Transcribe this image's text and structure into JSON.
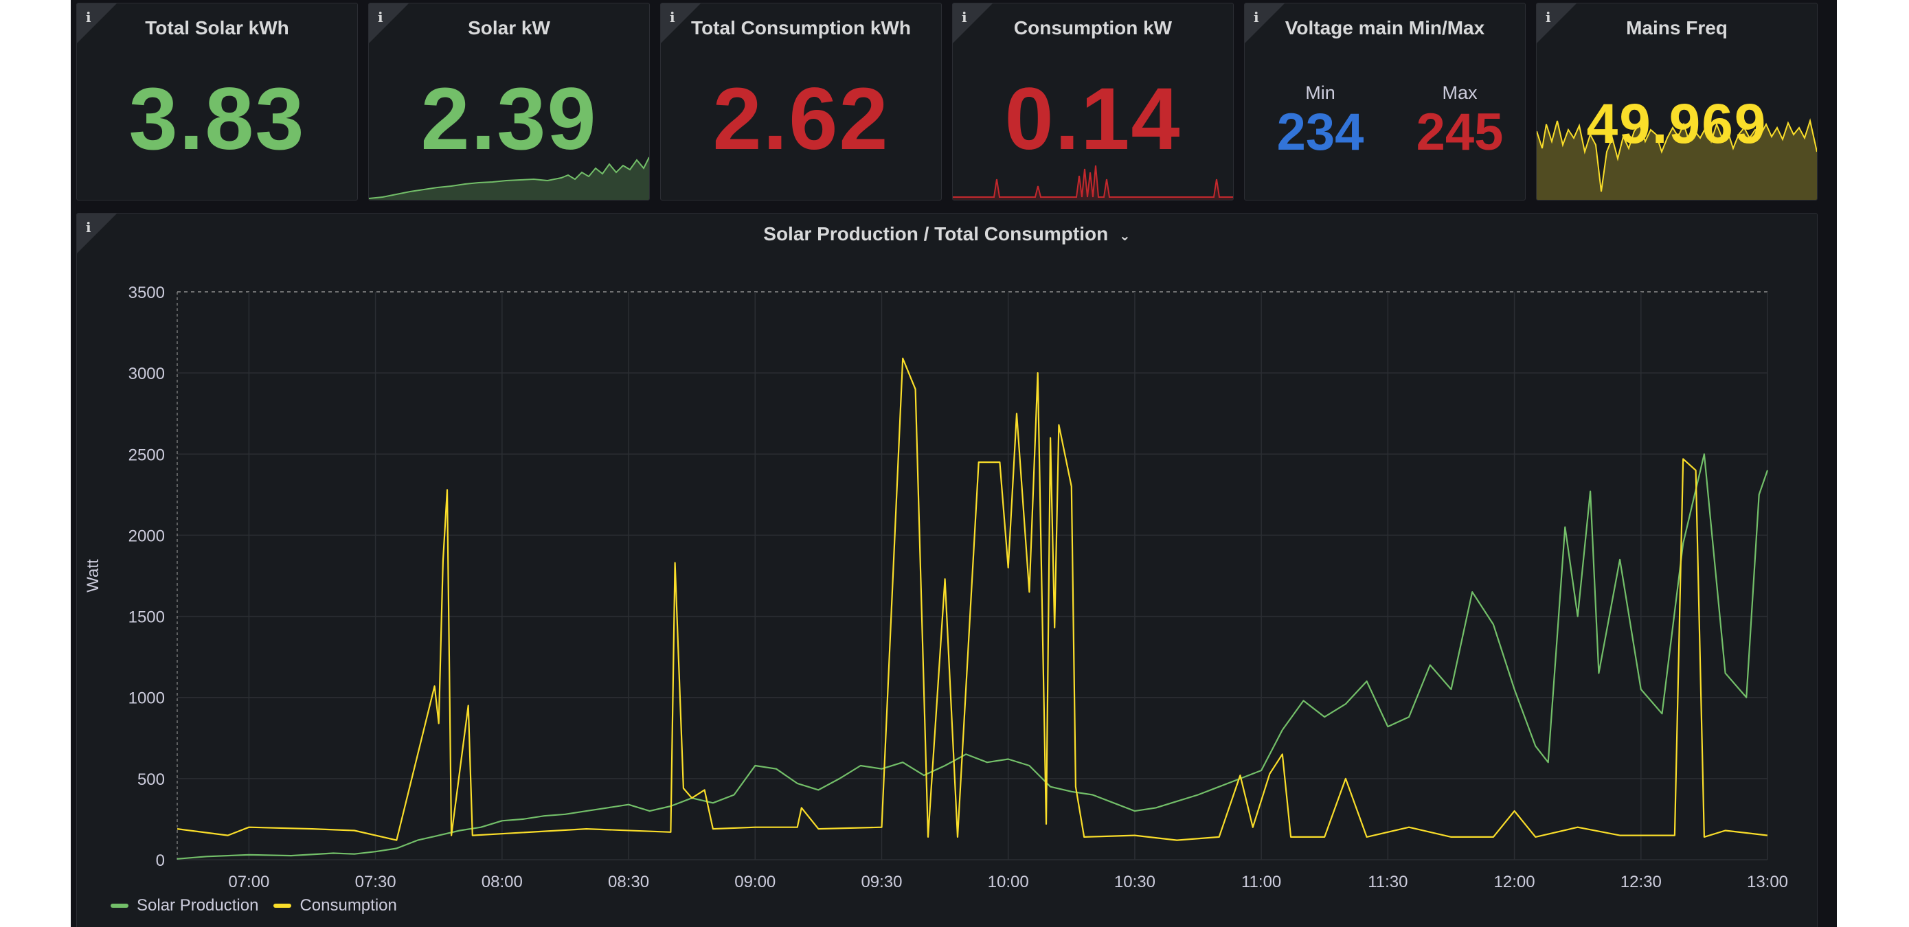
{
  "colors": {
    "green": "#73bf69",
    "red": "#c4282d",
    "blue": "#3274d9",
    "yellow": "#fade2a",
    "panel_bg": "#181b1f",
    "grid": "#2b2e33"
  },
  "stats": [
    {
      "title": "Total Solar kWh",
      "value": "3.83",
      "color": "green"
    },
    {
      "title": "Solar kW",
      "value": "2.39",
      "color": "green"
    },
    {
      "title": "Total Consumption kWh",
      "value": "2.62",
      "color": "red"
    },
    {
      "title": "Consumption kW",
      "value": "0.14",
      "color": "red"
    },
    {
      "title": "Voltage main Min/Max",
      "min_label": "Min",
      "min_value": "234",
      "max_label": "Max",
      "max_value": "245"
    },
    {
      "title": "Mains Freq",
      "value": "49.969",
      "color": "yellow"
    }
  ],
  "info_glyph": "i",
  "main_panel": {
    "title": "Solar Production / Total Consumption",
    "menu_icon": "chevron-down-icon"
  },
  "chart_data": {
    "type": "line",
    "title": "Solar Production / Total Consumption",
    "xlabel": "",
    "ylabel": "Watt",
    "x_tick_labels": [
      "07:00",
      "07:30",
      "08:00",
      "08:30",
      "09:00",
      "09:30",
      "10:00",
      "10:30",
      "11:00",
      "11:30",
      "12:00",
      "12:30",
      "13:00"
    ],
    "y_tick_labels": [
      "0",
      "500",
      "1000",
      "1500",
      "2000",
      "2500",
      "3000",
      "3500"
    ],
    "xlim": [
      "06:43",
      "13:00"
    ],
    "ylim": [
      0,
      3500
    ],
    "grid": true,
    "legend": "bottom-left",
    "series": [
      {
        "name": "Solar Production",
        "color": "#73bf69",
        "points": [
          [
            "06:43",
            5
          ],
          [
            "06:50",
            20
          ],
          [
            "07:00",
            30
          ],
          [
            "07:10",
            25
          ],
          [
            "07:20",
            40
          ],
          [
            "07:25",
            35
          ],
          [
            "07:30",
            50
          ],
          [
            "07:35",
            70
          ],
          [
            "07:40",
            120
          ],
          [
            "07:45",
            150
          ],
          [
            "07:50",
            180
          ],
          [
            "07:55",
            200
          ],
          [
            "08:00",
            240
          ],
          [
            "08:05",
            250
          ],
          [
            "08:10",
            270
          ],
          [
            "08:15",
            280
          ],
          [
            "08:20",
            300
          ],
          [
            "08:25",
            320
          ],
          [
            "08:30",
            340
          ],
          [
            "08:35",
            300
          ],
          [
            "08:40",
            330
          ],
          [
            "08:45",
            380
          ],
          [
            "08:50",
            350
          ],
          [
            "08:55",
            400
          ],
          [
            "09:00",
            580
          ],
          [
            "09:05",
            560
          ],
          [
            "09:10",
            470
          ],
          [
            "09:15",
            430
          ],
          [
            "09:20",
            500
          ],
          [
            "09:25",
            580
          ],
          [
            "09:30",
            560
          ],
          [
            "09:35",
            600
          ],
          [
            "09:40",
            520
          ],
          [
            "09:45",
            580
          ],
          [
            "09:50",
            650
          ],
          [
            "09:55",
            600
          ],
          [
            "10:00",
            620
          ],
          [
            "10:05",
            580
          ],
          [
            "10:10",
            450
          ],
          [
            "10:15",
            420
          ],
          [
            "10:20",
            400
          ],
          [
            "10:25",
            350
          ],
          [
            "10:30",
            300
          ],
          [
            "10:35",
            320
          ],
          [
            "10:40",
            360
          ],
          [
            "10:45",
            400
          ],
          [
            "10:50",
            450
          ],
          [
            "10:55",
            500
          ],
          [
            "11:00",
            550
          ],
          [
            "11:05",
            800
          ],
          [
            "11:10",
            980
          ],
          [
            "11:15",
            880
          ],
          [
            "11:20",
            960
          ],
          [
            "11:25",
            1100
          ],
          [
            "11:30",
            820
          ],
          [
            "11:35",
            880
          ],
          [
            "11:40",
            1200
          ],
          [
            "11:45",
            1050
          ],
          [
            "11:50",
            1650
          ],
          [
            "11:55",
            1450
          ],
          [
            "12:00",
            1050
          ],
          [
            "12:05",
            700
          ],
          [
            "12:08",
            600
          ],
          [
            "12:12",
            2050
          ],
          [
            "12:15",
            1500
          ],
          [
            "12:18",
            2270
          ],
          [
            "12:20",
            1150
          ],
          [
            "12:25",
            1850
          ],
          [
            "12:30",
            1050
          ],
          [
            "12:35",
            900
          ],
          [
            "12:40",
            1950
          ],
          [
            "12:45",
            2500
          ],
          [
            "12:50",
            1150
          ],
          [
            "12:55",
            1000
          ],
          [
            "12:58",
            2250
          ],
          [
            "13:00",
            2400
          ]
        ]
      },
      {
        "name": "Consumption",
        "color": "#fade2a",
        "points": [
          [
            "06:43",
            190
          ],
          [
            "06:55",
            150
          ],
          [
            "07:00",
            200
          ],
          [
            "07:15",
            190
          ],
          [
            "07:25",
            180
          ],
          [
            "07:35",
            120
          ],
          [
            "07:44",
            1070
          ],
          [
            "07:45",
            840
          ],
          [
            "07:46",
            1840
          ],
          [
            "07:47",
            2280
          ],
          [
            "07:48",
            150
          ],
          [
            "07:52",
            950
          ],
          [
            "07:53",
            150
          ],
          [
            "08:20",
            190
          ],
          [
            "08:40",
            170
          ],
          [
            "08:41",
            1830
          ],
          [
            "08:43",
            440
          ],
          [
            "08:45",
            380
          ],
          [
            "08:48",
            430
          ],
          [
            "08:50",
            190
          ],
          [
            "09:00",
            200
          ],
          [
            "09:10",
            200
          ],
          [
            "09:11",
            320
          ],
          [
            "09:15",
            190
          ],
          [
            "09:30",
            200
          ],
          [
            "09:35",
            3090
          ],
          [
            "09:38",
            2900
          ],
          [
            "09:41",
            140
          ],
          [
            "09:45",
            1730
          ],
          [
            "09:48",
            140
          ],
          [
            "09:53",
            2450
          ],
          [
            "09:58",
            2450
          ],
          [
            "10:00",
            1800
          ],
          [
            "10:02",
            2750
          ],
          [
            "10:05",
            1650
          ],
          [
            "10:07",
            3000
          ],
          [
            "10:09",
            220
          ],
          [
            "10:10",
            2600
          ],
          [
            "10:11",
            1430
          ],
          [
            "10:12",
            2680
          ],
          [
            "10:15",
            2300
          ],
          [
            "10:16",
            450
          ],
          [
            "10:18",
            140
          ],
          [
            "10:30",
            150
          ],
          [
            "10:40",
            120
          ],
          [
            "10:50",
            140
          ],
          [
            "10:55",
            520
          ],
          [
            "10:58",
            200
          ],
          [
            "11:02",
            530
          ],
          [
            "11:05",
            650
          ],
          [
            "11:07",
            140
          ],
          [
            "11:15",
            140
          ],
          [
            "11:20",
            500
          ],
          [
            "11:25",
            140
          ],
          [
            "11:35",
            200
          ],
          [
            "11:45",
            140
          ],
          [
            "11:55",
            140
          ],
          [
            "12:00",
            300
          ],
          [
            "12:05",
            140
          ],
          [
            "12:15",
            200
          ],
          [
            "12:25",
            150
          ],
          [
            "12:38",
            150
          ],
          [
            "12:40",
            2470
          ],
          [
            "12:43",
            2400
          ],
          [
            "12:45",
            140
          ],
          [
            "12:50",
            180
          ],
          [
            "13:00",
            150
          ]
        ]
      }
    ]
  }
}
